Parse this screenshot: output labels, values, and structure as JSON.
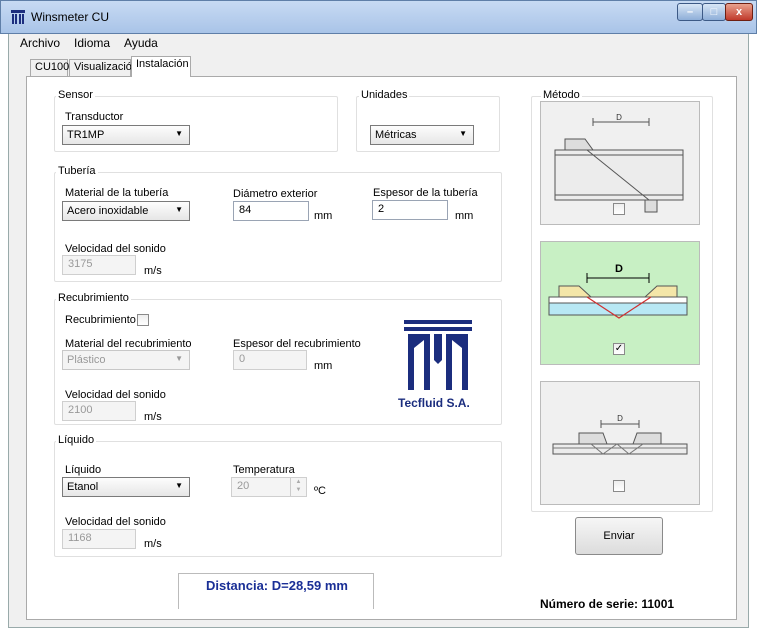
{
  "window": {
    "title": "Winsmeter CU",
    "min_glyph": "–",
    "max_glyph": "□",
    "close_glyph": "x"
  },
  "menu": [
    "Archivo",
    "Idioma",
    "Ayuda"
  ],
  "tabs": [
    "CU100",
    "Visualización",
    "Instalación"
  ],
  "sensor": {
    "group": "Sensor",
    "transductor_label": "Transductor",
    "transductor_value": "TR1MP"
  },
  "unidades": {
    "group": "Unidades",
    "value": "Métricas"
  },
  "tuberia": {
    "group": "Tubería",
    "material_label": "Material de la tubería",
    "material_value": "Acero inoxidable",
    "diametro_label": "Diámetro exterior",
    "diametro_value": "84",
    "diametro_unit": "mm",
    "espesor_label": "Espesor de la tubería",
    "espesor_value": "2",
    "espesor_unit": "mm",
    "velocidad_label": "Velocidad del sonido",
    "velocidad_value": "3175",
    "velocidad_unit": "m/s"
  },
  "recubrimiento": {
    "group": "Recubrimiento",
    "check_label": "Recubrimiento",
    "material_label": "Material del recubrimiento",
    "material_value": "Plástico",
    "espesor_label": "Espesor del recubrimiento",
    "espesor_value": "0",
    "espesor_unit": "mm",
    "velocidad_label": "Velocidad del sonido",
    "velocidad_value": "2100",
    "velocidad_unit": "m/s"
  },
  "liquido": {
    "group": "Líquido",
    "liquido_label": "Líquido",
    "liquido_value": "Etanol",
    "temp_label": "Temperatura",
    "temp_value": "20",
    "temp_unit": "ºC",
    "velocidad_label": "Velocidad del sonido",
    "velocidad_value": "1168",
    "velocidad_unit": "m/s"
  },
  "logo": {
    "company": "Tecfluid S.A."
  },
  "metodo": {
    "group": "Método",
    "d_label": "D",
    "checks": [
      false,
      true,
      false
    ],
    "check_glyph": "✓",
    "colors": {
      "selected_bg": "#c8f0c4",
      "pipe_blue": "#b8e8f4",
      "wedge_yellow": "#f4e6a8",
      "beam_red": "#d03030"
    }
  },
  "send_label": "Enviar",
  "distance": "Distancia: D=28,59 mm",
  "serial": "Número de serie: 11001",
  "colors": {
    "blue_text": "#1a2f96",
    "logo_blue": "#1b2d7e"
  }
}
